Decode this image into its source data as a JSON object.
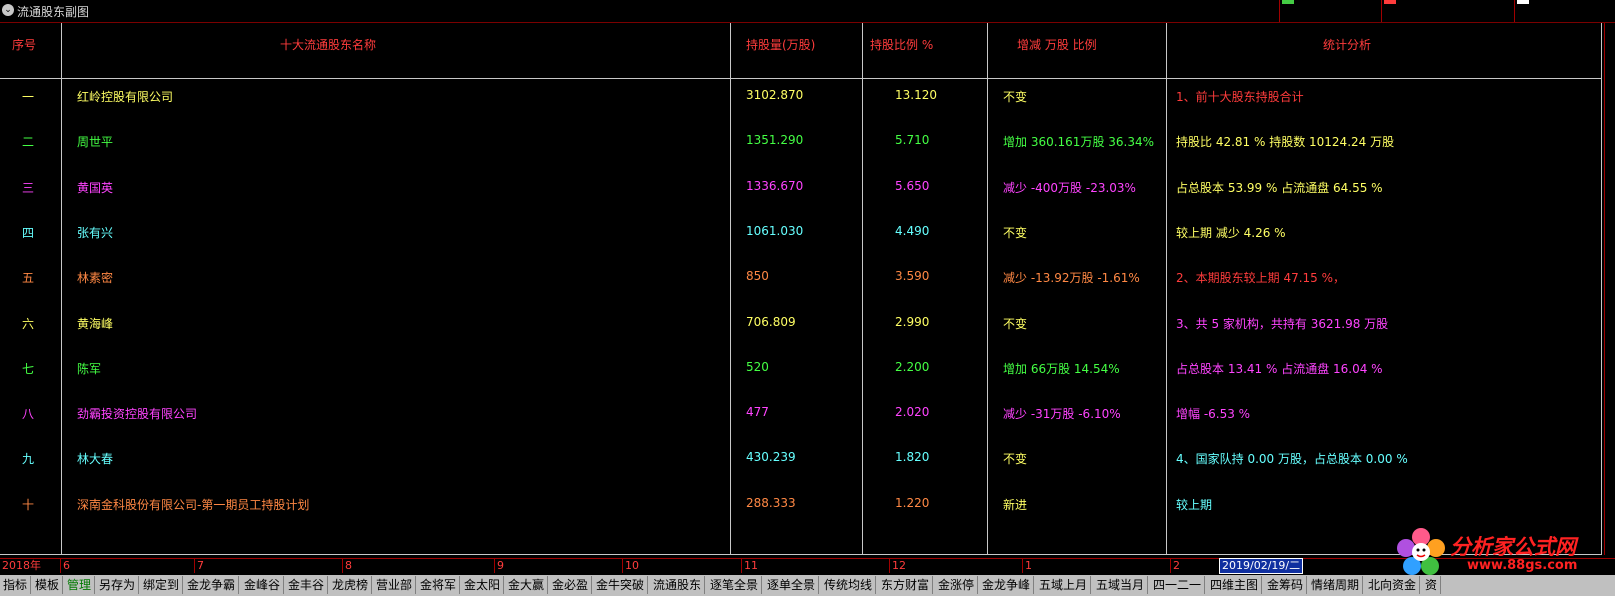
{
  "window": {
    "title": "流通股东副图"
  },
  "headers": [
    "序号",
    "十大流通股东名称",
    "持股量(万股)",
    "持股比例 %",
    "增减 万股 比例",
    "统计分析"
  ],
  "colors": {
    "yellow": "#ffff64",
    "green": "#44ff44",
    "magenta": "#ff44ff",
    "cyan": "#66ffff",
    "orange": "#ff8844",
    "red": "#ff3c3c",
    "white": "#d8d8d8"
  },
  "rows": [
    {
      "idx": "一",
      "name": "红岭控股有限公司",
      "qty": "3102.870",
      "pct": "13.120",
      "change": "不变",
      "stat": "1、前十大股东持股合计",
      "c": "yellow",
      "sc": "red"
    },
    {
      "idx": "二",
      "name": "周世平",
      "qty": "1351.290",
      "pct": "5.710",
      "change": "增加 360.161万股 36.34%",
      "stat": "持股比 42.81 %   持股数 10124.24 万股",
      "c": "green",
      "cc": "green",
      "sc": "yellow"
    },
    {
      "idx": "三",
      "name": "黄国英",
      "qty": "1336.670",
      "pct": "5.650",
      "change": "减少 -400万股 -23.03%",
      "stat": "占总股本 53.99 %   占流通盘 64.55 %",
      "c": "magenta",
      "cc": "magenta",
      "sc": "yellow"
    },
    {
      "idx": "四",
      "name": "张有兴",
      "qty": "1061.030",
      "pct": "4.490",
      "change": "不变",
      "stat": "较上期  减少  4.26  %",
      "c": "cyan",
      "sc": "yellow"
    },
    {
      "idx": "五",
      "name": "林素密",
      "qty": "850",
      "pct": "3.590",
      "change": "减少 -13.92万股 -1.61%",
      "stat": "2、本期股东较上期 47.15 %，",
      "c": "orange",
      "cc": "orange",
      "sc": "red"
    },
    {
      "idx": "六",
      "name": "黄海峰",
      "qty": "706.809",
      "pct": "2.990",
      "change": "不变",
      "stat": "3、共  5  家机构，共持有  3621.98  万股",
      "c": "yellow",
      "sc": "magenta"
    },
    {
      "idx": "七",
      "name": "陈军",
      "qty": "520",
      "pct": "2.200",
      "change": "增加 66万股 14.54%",
      "stat": "占总股本 13.41 %   占流通盘 16.04 %",
      "c": "green",
      "cc": "green",
      "sc": "magenta"
    },
    {
      "idx": "八",
      "name": "劲霸投资控股有限公司",
      "qty": "477",
      "pct": "2.020",
      "change": "减少 -31万股 -6.10%",
      "stat": "增幅 -6.53 %",
      "c": "magenta",
      "cc": "magenta",
      "sc": "magenta"
    },
    {
      "idx": "九",
      "name": "林大春",
      "qty": "430.239",
      "pct": "1.820",
      "change": "不变",
      "stat": "4、国家队持 0.00  万股，占总股本 0.00  %",
      "c": "cyan",
      "sc": "cyan"
    },
    {
      "idx": "十",
      "name": "深南金科股份有限公司-第一期员工持股计划",
      "qty": "288.333",
      "pct": "1.220",
      "change": "新进",
      "stat": "较上期",
      "c": "orange",
      "sc": "cyan"
    }
  ],
  "timeline": [
    "2018年",
    "6",
    "7",
    "8",
    "9",
    "10",
    "11",
    "12",
    "1",
    "2"
  ],
  "timeline_date": "2019/02/19/二",
  "tabs": [
    "指标",
    "模板",
    "管理",
    "另存为",
    "绑定到",
    "金龙争霸",
    "金峰谷",
    "金丰谷",
    "龙虎榜",
    "营业部",
    "金将军",
    "金太阳",
    "金大赢",
    "金必盈",
    "金牛突破",
    "流通股东",
    "逐笔全景",
    "逐单全景",
    "传统均线",
    "东方财富",
    "金涨停",
    "金龙争峰",
    "五域上月",
    "五域当月",
    "四一二一",
    "四维主图",
    "金筹码",
    "情绪周期",
    "北向资金",
    "资"
  ],
  "active_tab": "管理",
  "logo": {
    "text": "分析家公式网",
    "url": "www.88gs.com"
  }
}
